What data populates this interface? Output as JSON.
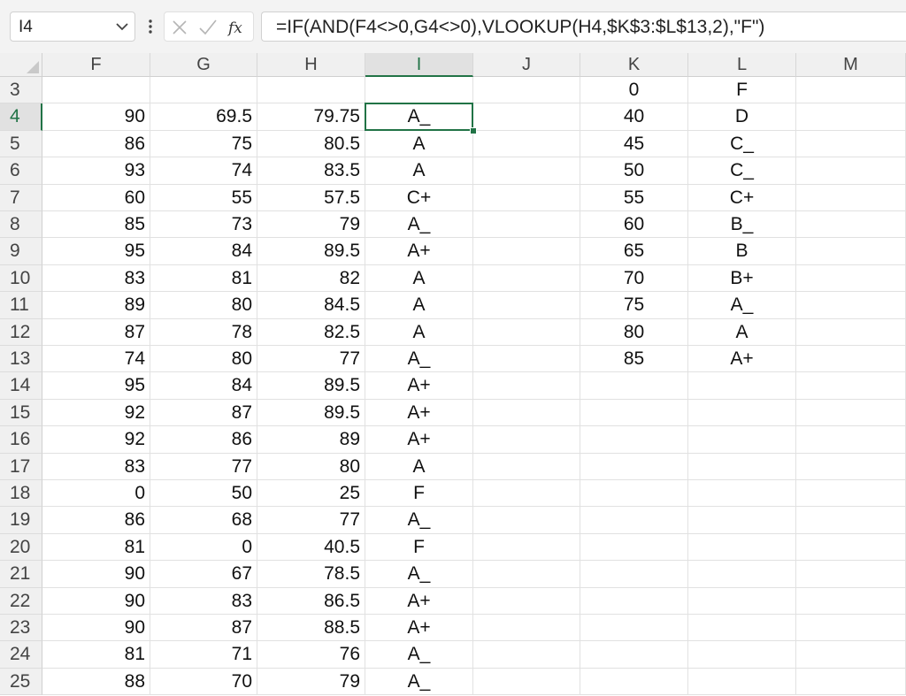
{
  "formula_bar": {
    "name_box": "I4",
    "cancel_icon": "close-icon",
    "enter_icon": "check-icon",
    "fx_label": "fx",
    "formula": "=IF(AND(F4<>0,G4<>0),VLOOKUP(H4,$K$3:$L$13,2),\"F\")"
  },
  "sheet": {
    "selected_cell": "I4",
    "columns": [
      "F",
      "G",
      "H",
      "I",
      "J",
      "K",
      "L",
      "M"
    ],
    "rows": [
      {
        "n": "3",
        "F": "",
        "G": "",
        "H": "",
        "I": "",
        "K": "0",
        "L": "F"
      },
      {
        "n": "4",
        "F": "90",
        "G": "69.5",
        "H": "79.75",
        "I": "A_",
        "K": "40",
        "L": "D"
      },
      {
        "n": "5",
        "F": "86",
        "G": "75",
        "H": "80.5",
        "I": "A",
        "K": "45",
        "L": "C_"
      },
      {
        "n": "6",
        "F": "93",
        "G": "74",
        "H": "83.5",
        "I": "A",
        "K": "50",
        "L": "C_"
      },
      {
        "n": "7",
        "F": "60",
        "G": "55",
        "H": "57.5",
        "I": "C+",
        "K": "55",
        "L": "C+"
      },
      {
        "n": "8",
        "F": "85",
        "G": "73",
        "H": "79",
        "I": "A_",
        "K": "60",
        "L": "B_"
      },
      {
        "n": "9",
        "F": "95",
        "G": "84",
        "H": "89.5",
        "I": "A+",
        "K": "65",
        "L": "B"
      },
      {
        "n": "10",
        "F": "83",
        "G": "81",
        "H": "82",
        "I": "A",
        "K": "70",
        "L": "B+"
      },
      {
        "n": "11",
        "F": "89",
        "G": "80",
        "H": "84.5",
        "I": "A",
        "K": "75",
        "L": "A_"
      },
      {
        "n": "12",
        "F": "87",
        "G": "78",
        "H": "82.5",
        "I": "A",
        "K": "80",
        "L": "A"
      },
      {
        "n": "13",
        "F": "74",
        "G": "80",
        "H": "77",
        "I": "A_",
        "K": "85",
        "L": "A+"
      },
      {
        "n": "14",
        "F": "95",
        "G": "84",
        "H": "89.5",
        "I": "A+"
      },
      {
        "n": "15",
        "F": "92",
        "G": "87",
        "H": "89.5",
        "I": "A+"
      },
      {
        "n": "16",
        "F": "92",
        "G": "86",
        "H": "89",
        "I": "A+"
      },
      {
        "n": "17",
        "F": "83",
        "G": "77",
        "H": "80",
        "I": "A"
      },
      {
        "n": "18",
        "F": "0",
        "G": "50",
        "H": "25",
        "I": "F"
      },
      {
        "n": "19",
        "F": "86",
        "G": "68",
        "H": "77",
        "I": "A_"
      },
      {
        "n": "20",
        "F": "81",
        "G": "0",
        "H": "40.5",
        "I": "F"
      },
      {
        "n": "21",
        "F": "90",
        "G": "67",
        "H": "78.5",
        "I": "A_"
      },
      {
        "n": "22",
        "F": "90",
        "G": "83",
        "H": "86.5",
        "I": "A+"
      },
      {
        "n": "23",
        "F": "90",
        "G": "87",
        "H": "88.5",
        "I": "A+"
      },
      {
        "n": "24",
        "F": "81",
        "G": "71",
        "H": "76",
        "I": "A_"
      },
      {
        "n": "25",
        "F": "88",
        "G": "70",
        "H": "79",
        "I": "A_"
      }
    ]
  }
}
